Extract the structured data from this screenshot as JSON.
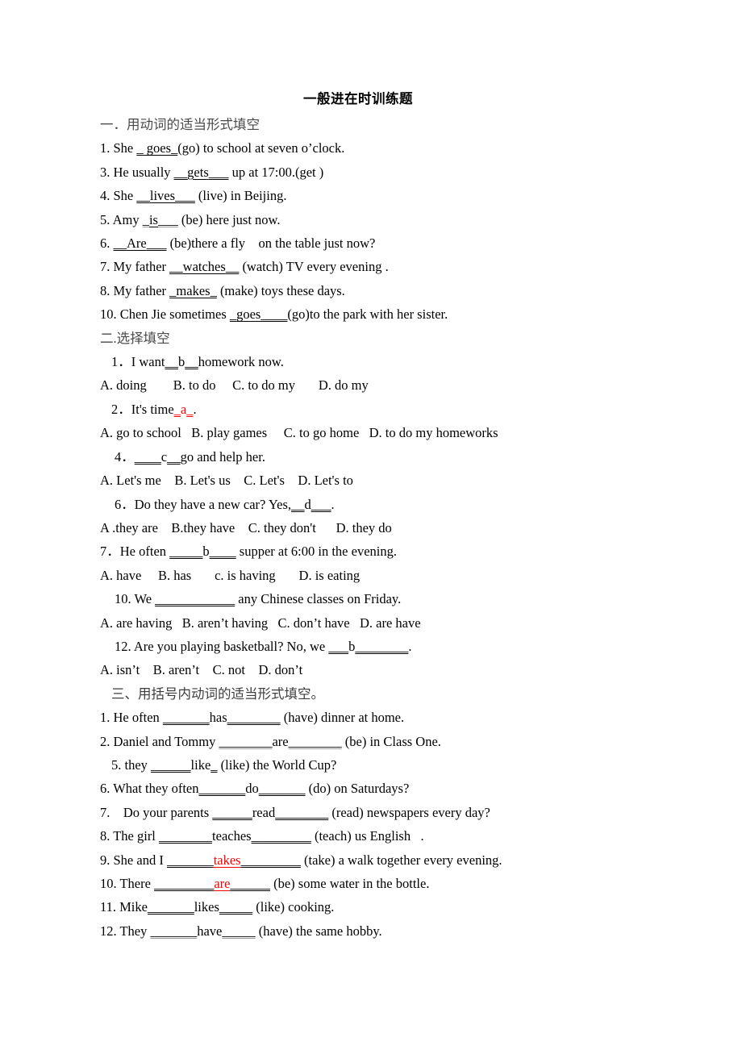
{
  "document": {
    "title": "一般进在时训练题",
    "accent_red": "#ff0000",
    "text_color": "#000000",
    "heading_color": "#4a4a4a",
    "sections": [
      {
        "heading": "一．用动词的适当形式填空",
        "items": [
          {
            "number": "1.",
            "text": "1. She _ goes_(go) to school at seven o’clock."
          },
          {
            "number": "3.",
            "text": "3. He usually __gets___ up at 17:00.(get )"
          },
          {
            "number": "4.",
            "text": "4. She __lives___ (live) in Beijing."
          },
          {
            "number": "5.",
            "text": "5. Amy _is___ (be) here just now."
          },
          {
            "number": "6.",
            "text": "6. __Are___ (be)there a fly    on the table just now?"
          },
          {
            "number": "7.",
            "text": "7. My father __watches__ (watch) TV every evening ."
          },
          {
            "number": "8.",
            "text": "8. My father _makes_ (make) toys these days."
          },
          {
            "number": "10.",
            "text": "10. Chen Jie sometimes _goes____(go)to the park with her sister."
          }
        ]
      },
      {
        "heading": "二.选择填空",
        "items": [
          {
            "number": "1．",
            "text": "1．I want__b__homework now."
          },
          {
            "number": "",
            "text": "A. doing        B. to do     C. to do my       D. do my"
          },
          {
            "number": "2．",
            "text": "2．It's time_ a_."
          },
          {
            "number": "",
            "text": "A. go to school   B. play games     C. to go home   D. to do my homeworks"
          },
          {
            "number": "4．",
            "text": "4．____c__go and help her."
          },
          {
            "number": "",
            "text": "A. Let's me    B. Let's us    C. Let's    D. Let's to"
          },
          {
            "number": "6．",
            "text": "6．Do they have a new car? Yes,__d___."
          },
          {
            "number": "",
            "text": "A .they are    B.they have    C. they don't      D. they do"
          },
          {
            "number": "7．",
            "text": "7．He often _____b____ supper at 6:00 in the evening."
          },
          {
            "number": "",
            "text": "A. have     B. has       c. is having       D. is eating"
          },
          {
            "number": "10.",
            "text": "10. We ____________ any Chinese classes on Friday."
          },
          {
            "number": "",
            "text": "A. are having   B. aren’t having   C. don’t have   D. are have"
          },
          {
            "number": "12.",
            "text": "12. Are you playing basketball? No, we ___b_______."
          },
          {
            "number": "",
            "text": "A. isn’t    B. aren’t    C. not    D. don’t"
          }
        ]
      },
      {
        "heading": "三、用括号内动词的适当形式填空。",
        "items": [
          {
            "number": "1.",
            "text": "1. He often _______has ________ (have) dinner at home."
          },
          {
            "number": "2.",
            "text": "2. Daniel and Tommy ________are________ (be) in Class One."
          },
          {
            "number": "5.",
            "text": "5. they ______like_ (like) the World Cup?"
          },
          {
            "number": "6.",
            "text": "6. What they often_______do_______ (do) on Saturdays?"
          },
          {
            "number": "7.",
            "text": "7.    Do your parents ______read________ (read) newspapers every day?"
          },
          {
            "number": "8.",
            "text": "8. The girl ________teaches_________ (teach) us English   ."
          },
          {
            "number": "9.",
            "text": "9. She and I _______takes__________ (take) a walk together every evening."
          },
          {
            "number": "10.",
            "text": "10. There _________are______ (be) some water in the bottle."
          },
          {
            "number": "11.",
            "text": "11. Mike________likes______ (like) cooking."
          },
          {
            "number": "12.",
            "text": "12. They ________have______ (have) the same hobby."
          }
        ]
      }
    ],
    "fragments": {
      "s1_1_a": "1. She ",
      "s1_1_b": " goes",
      "s1_1_c": "(go) to school at seven o’clock.",
      "s1_3_a": "3. He usually ",
      "s1_3_b": "gets",
      "s1_3_c": " up at 17:00.(get )",
      "s1_4_a": "4. She ",
      "s1_4_b": "lives",
      "s1_4_c": " (live) in Beijing.",
      "s1_5_a": "5. Amy ",
      "s1_5_b": "is",
      "s1_5_c": " (be) here just now.",
      "s1_6_a": "6. ",
      "s1_6_b": "Are",
      "s1_6_c": " (be)there a fly    on the table just now?",
      "s1_7_a": "7. My father ",
      "s1_7_b": "watches",
      "s1_7_c": " (watch) TV every evening .",
      "s1_8_a": "8. My father ",
      "s1_8_b": "makes",
      "s1_8_c": " (make) toys these days.",
      "s1_10_a": "10. Chen Jie sometimes ",
      "s1_10_b": "goes",
      "s1_10_c": "(go)to the park with her sister.",
      "s2_q1_a": "1．I want",
      "s2_q1_b": "b",
      "s2_q1_c": "homework now.",
      "s2_o1": "A. doing        B. to do     C. to do my       D. do my",
      "s2_q2_a": "2．It's time",
      "s2_q2_b": "a",
      "s2_q2_c": ".",
      "s2_o2": "A. go to school   B. play games     C. to go home   D. to do my homeworks",
      "s2_q4_a": "4．",
      "s2_q4_b": "c",
      "s2_q4_c": "go and help her.",
      "s2_o4": "A. Let's me    B. Let's us    C. Let's    D. Let's to",
      "s2_q6_a": "6．Do they have a new car? Yes,",
      "s2_q6_b": "d",
      "s2_q6_c": ".",
      "s2_o6": "A .they are    B.they have    C. they don't      D. they do",
      "s2_q7_a": "7．He often ",
      "s2_q7_b": "b",
      "s2_q7_c": " supper at 6:00 in the evening.",
      "s2_o7": "A. have     B. has       c. is having       D. is eating",
      "s2_q10_a": "10. We ",
      "s2_q10_b": "",
      "s2_q10_c": " any Chinese classes on Friday.",
      "s2_o10": "A. are having   B. aren’t having   C. don’t have   D. are have",
      "s2_q12_a": "12. Are you playing basketball? No, we ",
      "s2_q12_b": "b",
      "s2_q12_c": ".",
      "s2_o12": "A. isn’t    B. aren’t    C. not    D. don’t",
      "s3_1_a": "1. He often ",
      "s3_1_b": "has",
      "s3_1_c": " (have) dinner at home.",
      "s3_2_a": "2. Daniel and Tommy ",
      "s3_2_b": "are",
      "s3_2_c": " (be) in Class One.",
      "s3_5_a": "5. they ",
      "s3_5_b": "like",
      "s3_5_c": " (like) the World Cup?",
      "s3_6_a": "6. What they often",
      "s3_6_b": "do",
      "s3_6_c": " (do) on Saturdays?",
      "s3_7_a": "7.    Do your parents ",
      "s3_7_b": "read",
      "s3_7_c": " (read) newspapers every day?",
      "s3_8_a": "8. The girl ",
      "s3_8_b": "teaches",
      "s3_8_c": " (teach) us English   .",
      "s3_9_a": "9. She and I ",
      "s3_9_b": "takes",
      "s3_9_c": " (take) a walk together every evening.",
      "s3_10_a": "10. There ",
      "s3_10_b": "are",
      "s3_10_c": " (be) some water in the bottle.",
      "s3_11_a": "11. Mike",
      "s3_11_b": "likes",
      "s3_11_c": " (like) cooking.",
      "s3_12_a": "12. They ",
      "s3_12_b": "have",
      "s3_12_c": " (have) the same hobby."
    },
    "blanks": {
      "b1": "_",
      "b2": "__",
      "b3": "___",
      "b4": "____",
      "b5": "_____",
      "b6": "______",
      "b7": "_______",
      "b8": "________",
      "b9": "_________",
      "b12": "____________"
    }
  }
}
